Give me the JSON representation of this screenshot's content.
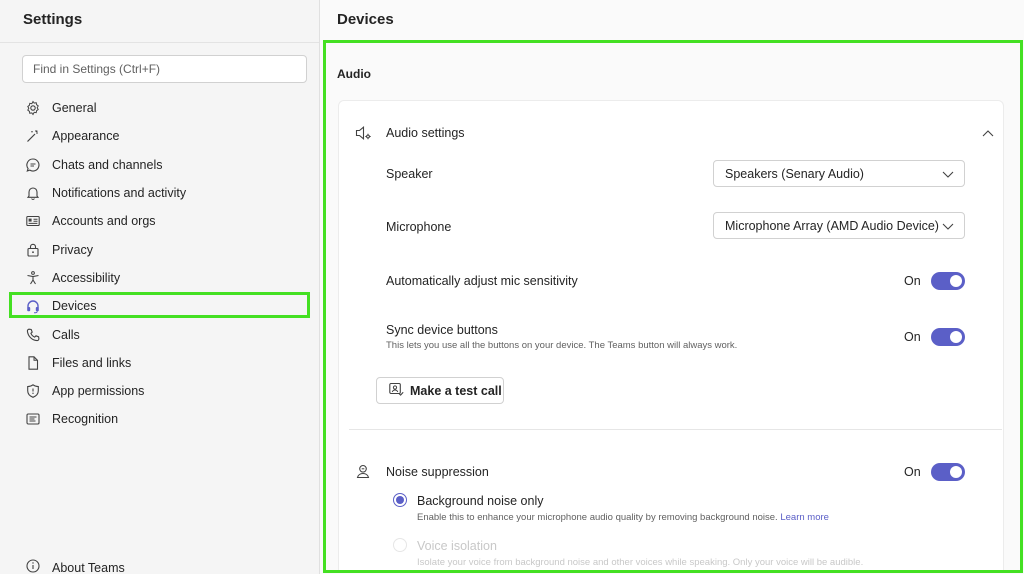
{
  "sidebar": {
    "title": "Settings",
    "search_placeholder": "Find in Settings (Ctrl+F)",
    "items": [
      {
        "label": "General",
        "icon": "gear-icon"
      },
      {
        "label": "Appearance",
        "icon": "magic-wand-icon"
      },
      {
        "label": "Chats and channels",
        "icon": "chat-icon"
      },
      {
        "label": "Notifications and activity",
        "icon": "bell-icon"
      },
      {
        "label": "Accounts and orgs",
        "icon": "id-card-icon"
      },
      {
        "label": "Privacy",
        "icon": "lock-icon"
      },
      {
        "label": "Accessibility",
        "icon": "accessibility-icon"
      },
      {
        "label": "Devices",
        "icon": "headset-icon"
      },
      {
        "label": "Calls",
        "icon": "phone-icon"
      },
      {
        "label": "Files and links",
        "icon": "document-icon"
      },
      {
        "label": "App permissions",
        "icon": "shield-icon"
      },
      {
        "label": "Recognition",
        "icon": "recognition-icon"
      }
    ],
    "about": "About Teams"
  },
  "main": {
    "title": "Devices",
    "section": "Audio",
    "audio_settings": {
      "header": "Audio settings",
      "speaker_label": "Speaker",
      "speaker_value": "Speakers (Senary Audio)",
      "microphone_label": "Microphone",
      "microphone_value": "Microphone Array (AMD Audio Device)",
      "auto_adjust_label": "Automatically adjust mic sensitivity",
      "auto_adjust_state": "On",
      "sync_label": "Sync device buttons",
      "sync_sub": "This lets you use all the buttons on your device. The Teams button will always work.",
      "sync_state": "On",
      "test_call": "Make a test call"
    },
    "noise": {
      "header": "Noise suppression",
      "state": "On",
      "option1_label": "Background noise only",
      "option1_sub": "Enable this to enhance your microphone audio quality by removing background noise.",
      "learn_more": "Learn more",
      "option2_label": "Voice isolation",
      "option2_sub": "Isolate your voice from background noise and other voices while speaking. Only your voice will be audible."
    }
  },
  "colors": {
    "accent": "#5b5fc7",
    "highlight": "#44e022"
  }
}
